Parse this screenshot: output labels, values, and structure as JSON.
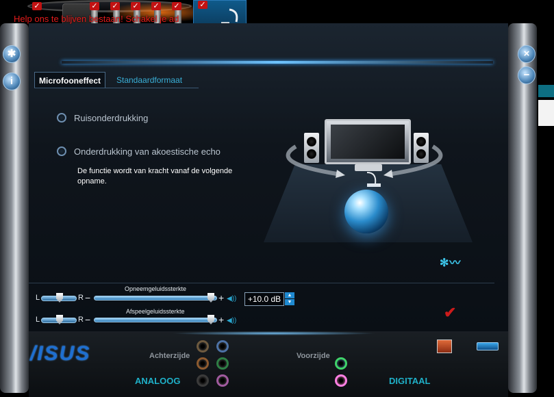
{
  "window": {
    "warning_text": "Help ons te blijven bestaan! Schakel je ad"
  },
  "sidebar": {
    "settings_icon": "gear-icon",
    "info_symbol": "i",
    "close_symbol": "×",
    "minimize_symbol": "−"
  },
  "tabs": [
    {
      "label": "Microfooneffect",
      "active": true
    },
    {
      "label": "Standaardformaat",
      "active": false
    }
  ],
  "effects": {
    "noise_suppression": "Ruisonderdrukking",
    "echo_cancellation": "Onderdrukking van akoestische echo",
    "note": "De functie wordt van kracht vanaf de volgende opname."
  },
  "sliders": {
    "recording": {
      "title": "Opneemgeluidssterkte",
      "left": "L",
      "right": "R",
      "minus": "−",
      "plus": "+",
      "gain_db": "+10.0 dB",
      "balance_pct": 50,
      "level_pct": 97
    },
    "playback": {
      "title": "Afspeelgeluidssterkte",
      "left": "L",
      "right": "R",
      "minus": "−",
      "plus": "+",
      "balance_pct": 50,
      "level_pct": 97
    }
  },
  "spin": {
    "up": "▲",
    "down": "▼"
  },
  "deck": {
    "brand": "/ISUS",
    "rear_label": "Achterzijde",
    "front_label": "Voorzijde",
    "analog_label": "ANALOOG",
    "digital_label": "DIGITAAL"
  },
  "colors": {
    "accent": "#3ab0d8",
    "warning": "#e41b1b",
    "brand": "#1e6fd1"
  }
}
